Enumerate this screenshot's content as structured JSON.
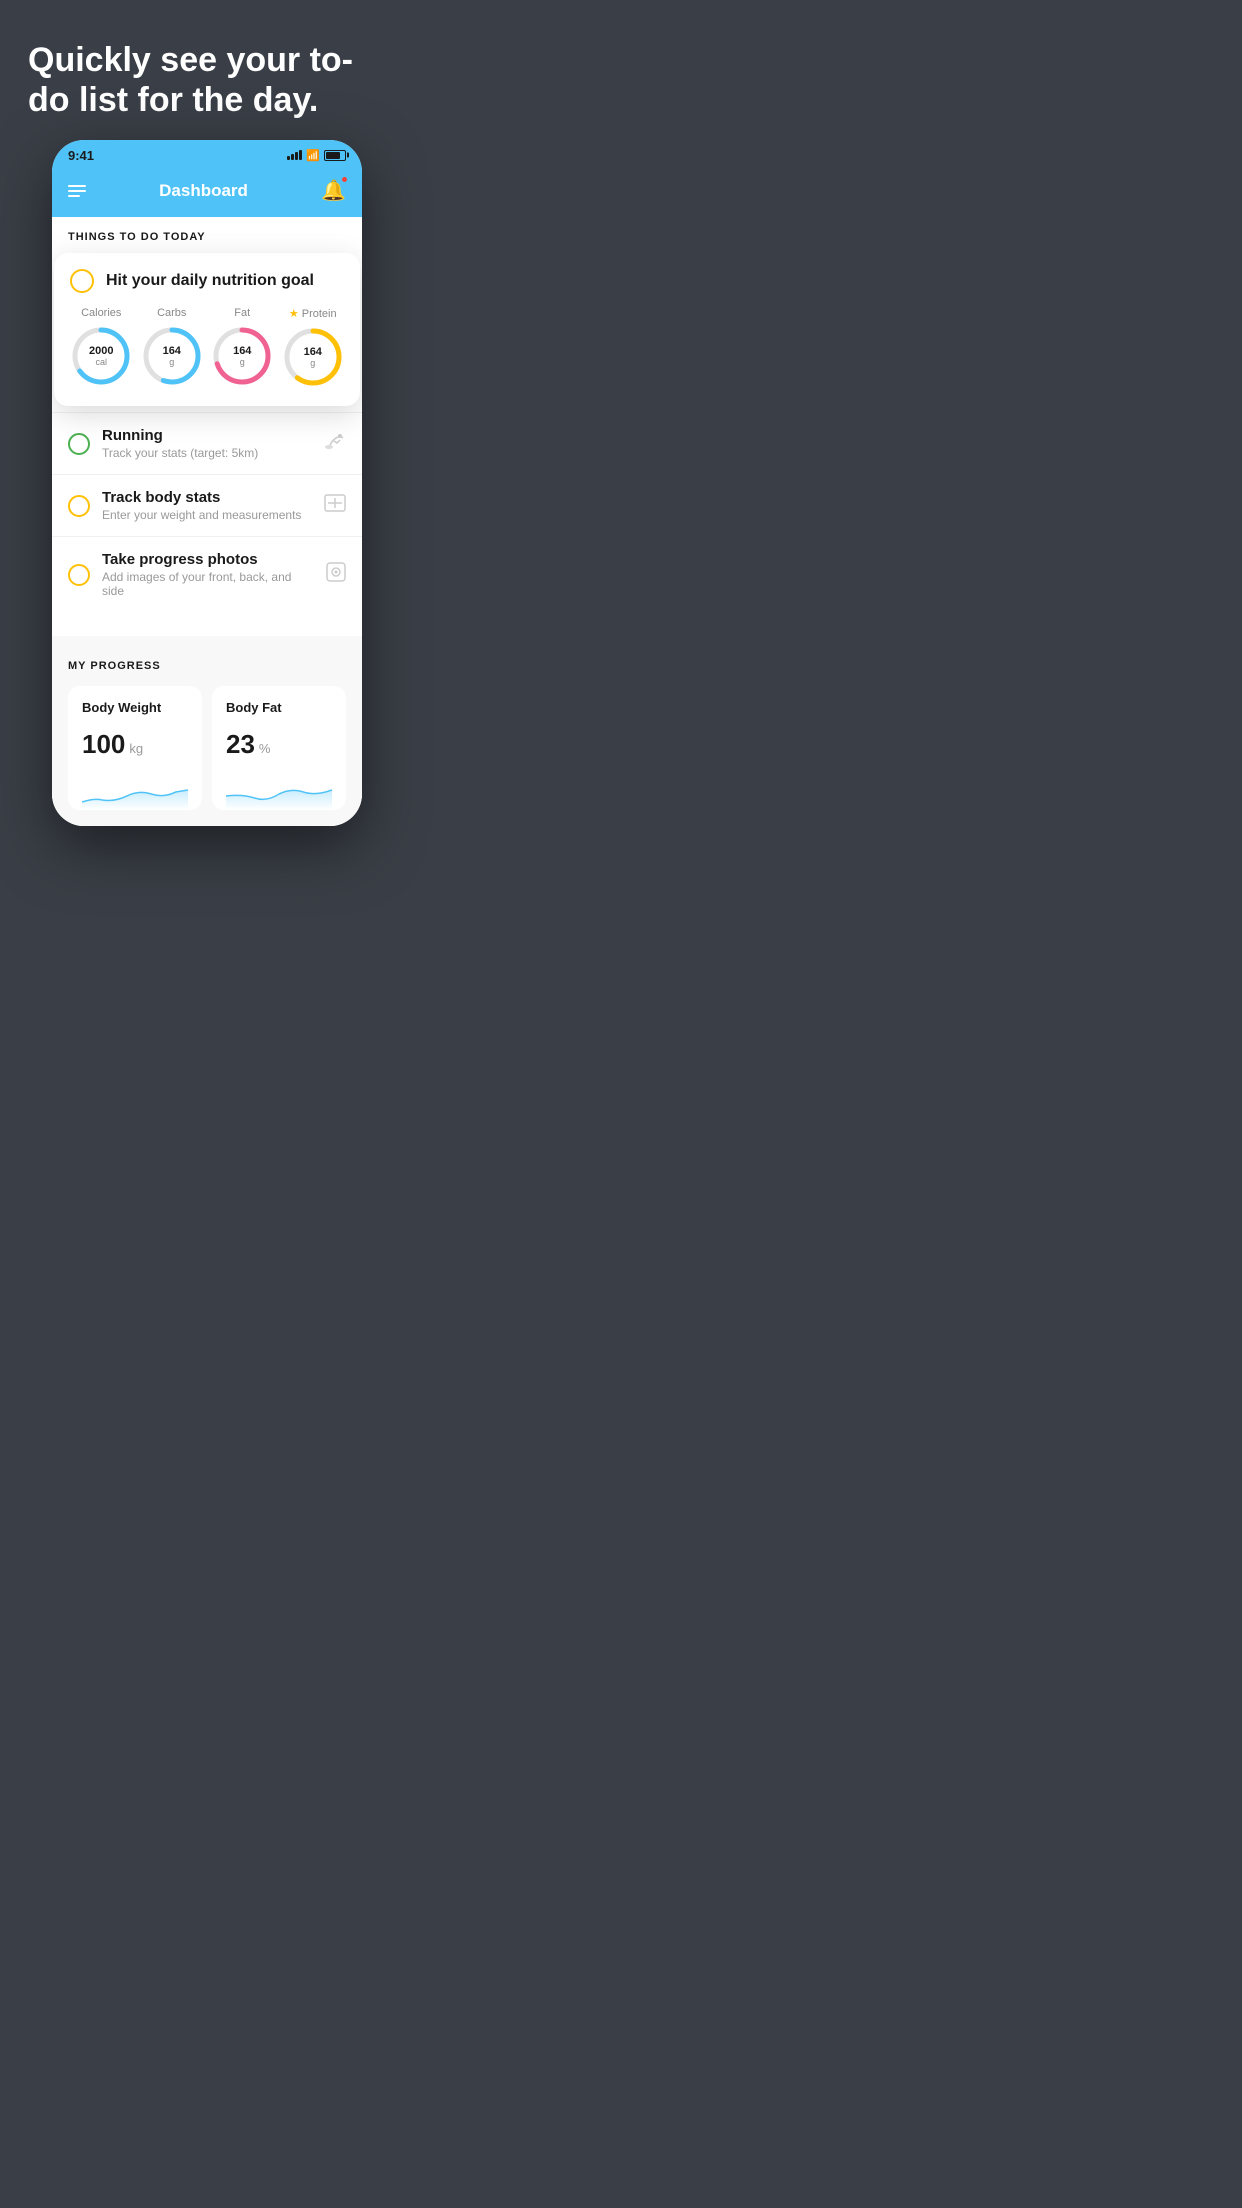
{
  "background_color": "#3a3f47",
  "hero": {
    "title": "Quickly see your to-do list for the day."
  },
  "phone": {
    "status_bar": {
      "time": "9:41"
    },
    "header": {
      "title": "Dashboard"
    },
    "section_label": "THINGS TO DO TODAY",
    "nutrition_card": {
      "title": "Hit your daily nutrition goal",
      "stats": [
        {
          "label": "Calories",
          "value": "2000",
          "unit": "cal",
          "color": "#4fc3f7",
          "track_color": "#e0e0e0",
          "percent": 65
        },
        {
          "label": "Carbs",
          "value": "164",
          "unit": "g",
          "color": "#4fc3f7",
          "track_color": "#e0e0e0",
          "percent": 55
        },
        {
          "label": "Fat",
          "value": "164",
          "unit": "g",
          "color": "#f06292",
          "track_color": "#e0e0e0",
          "percent": 70
        },
        {
          "label": "Protein",
          "value": "164",
          "unit": "g",
          "color": "#FFC107",
          "track_color": "#e0e0e0",
          "percent": 60,
          "starred": true
        }
      ]
    },
    "todo_items": [
      {
        "id": "running",
        "title": "Running",
        "subtitle": "Track your stats (target: 5km)",
        "circle_color": "green",
        "icon": "👟"
      },
      {
        "id": "body-stats",
        "title": "Track body stats",
        "subtitle": "Enter your weight and measurements",
        "circle_color": "yellow",
        "icon": "⊡"
      },
      {
        "id": "progress-photos",
        "title": "Take progress photos",
        "subtitle": "Add images of your front, back, and side",
        "circle_color": "yellow",
        "icon": "👤"
      }
    ],
    "progress_section": {
      "title": "MY PROGRESS",
      "cards": [
        {
          "id": "body-weight",
          "title": "Body Weight",
          "value": "100",
          "unit": "kg"
        },
        {
          "id": "body-fat",
          "title": "Body Fat",
          "value": "23",
          "unit": "%"
        }
      ]
    }
  }
}
